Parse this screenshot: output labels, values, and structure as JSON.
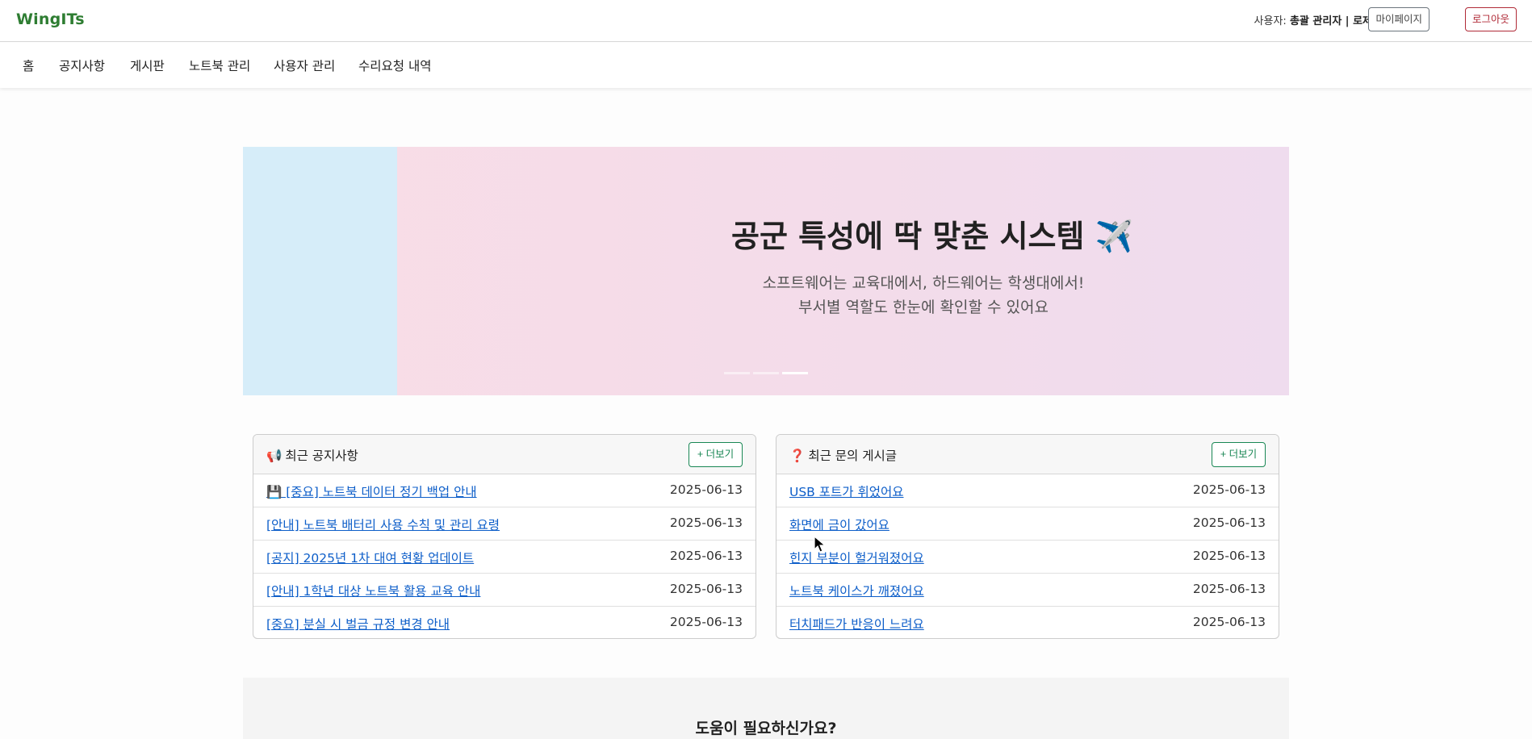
{
  "header": {
    "brand": "WingITs",
    "user_prefix": "사용자: ",
    "user_role": "총괄 관리자 | 로제",
    "mypage_label": "마이페이지",
    "logout_label": "로그아웃"
  },
  "nav": {
    "items": [
      "홈",
      "공지사항",
      "게시판",
      "노트북 관리",
      "사용자 관리",
      "수리요청 내역"
    ]
  },
  "banner": {
    "title": "공군 특성에 딱 맞춘 시스템 ✈️",
    "subtitle_line1": "소프트웨어는 교육대에서, 하드웨어는 학생대에서!",
    "subtitle_line2": "부서별 역할도 한눈에 확인할 수 있어요",
    "slide_count": 3,
    "active_slide": 3
  },
  "notices": {
    "icon": "📢",
    "title": "최근 공지사항",
    "more_label": "+ 더보기",
    "items": [
      {
        "title": "💾 [중요] 노트북 데이터 정기 백업 안내",
        "date": "2025-06-13"
      },
      {
        "title": "[안내] 노트북 배터리 사용 수칙 및 관리 요령",
        "date": "2025-06-13"
      },
      {
        "title": "[공지] 2025년 1차 대여 현황 업데이트",
        "date": "2025-06-13"
      },
      {
        "title": "[안내] 1학년 대상 노트북 활용 교육 안내",
        "date": "2025-06-13"
      },
      {
        "title": "[중요] 분실 시 벌금 규정 변경 안내",
        "date": "2025-06-13"
      }
    ]
  },
  "inquiries": {
    "icon": "❓",
    "title": "최근 문의 게시글",
    "more_label": "+ 더보기",
    "items": [
      {
        "title": "USB 포트가 휘었어요",
        "date": "2025-06-13"
      },
      {
        "title": "화면에 금이 갔어요",
        "date": "2025-06-13"
      },
      {
        "title": "힌지 부분이 헐거워졌어요",
        "date": "2025-06-13"
      },
      {
        "title": "노트북 케이스가 깨졌어요",
        "date": "2025-06-13"
      },
      {
        "title": "터치패드가 반응이 느려요",
        "date": "2025-06-13"
      }
    ]
  },
  "help": {
    "title": "도움이 필요하신가요?"
  }
}
